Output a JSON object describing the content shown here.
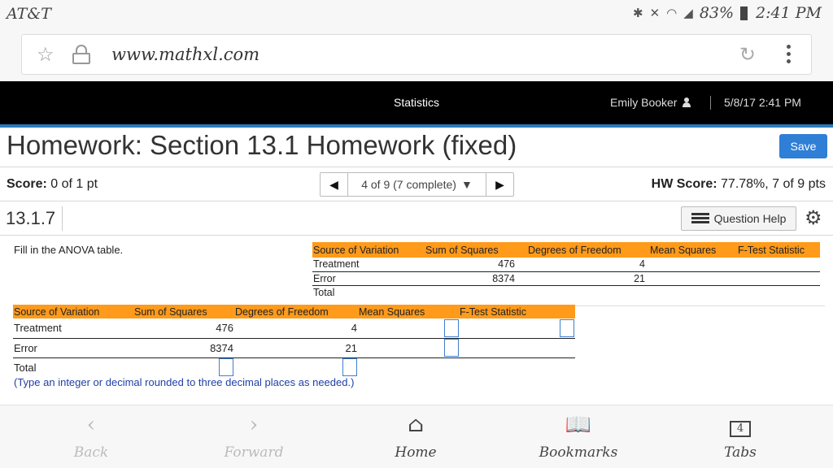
{
  "statusbar": {
    "carrier": "AT&T",
    "battery": "83%",
    "time": "2:41 PM"
  },
  "browser": {
    "url": "www.mathxl.com"
  },
  "header": {
    "title": "Statistics",
    "user": "Emily Booker",
    "datetime": "5/8/17 2:41 PM"
  },
  "homework": {
    "title": "Homework: Section 13.1 Homework (fixed)",
    "save_label": "Save",
    "score_label": "Score:",
    "score_value": "0 of 1 pt",
    "nav_text": "4 of 9 (7 complete)",
    "hw_score_label": "HW Score:",
    "hw_score_value": "77.78%, 7 of 9 pts",
    "question_number": "13.1.7",
    "help_label": "Question Help",
    "instructions": "Fill in the ANOVA table.",
    "hint": "(Type an integer or decimal rounded to three decimal places as needed.)"
  },
  "anova": {
    "headers": [
      "Source of Variation",
      "Sum of Squares",
      "Degrees of Freedom",
      "Mean Squares",
      "F-Test Statistic"
    ],
    "rows": [
      {
        "source": "Treatment",
        "ss": "476",
        "df": "4"
      },
      {
        "source": "Error",
        "ss": "8374",
        "df": "21"
      },
      {
        "source": "Total",
        "ss": "",
        "df": ""
      }
    ]
  },
  "bottom_nav": {
    "back": "Back",
    "forward": "Forward",
    "home": "Home",
    "bookmarks": "Bookmarks",
    "tabs": "Tabs",
    "tabs_count": "4"
  }
}
